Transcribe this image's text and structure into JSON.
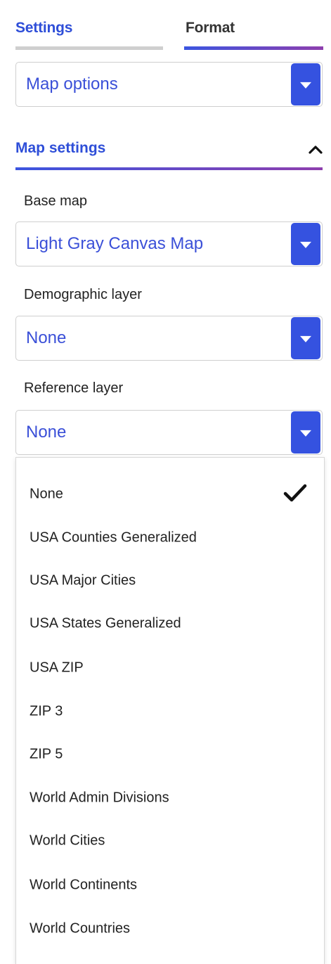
{
  "tabs": {
    "settings": "Settings",
    "format": "Format"
  },
  "map_options": {
    "value": "Map options"
  },
  "section": {
    "title": "Map settings",
    "icon": "chevron-up-icon"
  },
  "base_map": {
    "label": "Base map",
    "value": "Light Gray Canvas Map"
  },
  "demographic_layer": {
    "label": "Demographic layer",
    "value": "None"
  },
  "reference_layer": {
    "label": "Reference layer",
    "value": "None"
  },
  "dropdown": {
    "selected_icon": "check-icon",
    "options": [
      {
        "label": "None",
        "selected": true
      },
      {
        "label": "USA Counties Generalized"
      },
      {
        "label": "USA Major Cities"
      },
      {
        "label": "USA States Generalized"
      },
      {
        "label": "USA ZIP"
      },
      {
        "label": "ZIP 3"
      },
      {
        "label": "ZIP 5"
      },
      {
        "label": "World Admin Divisions"
      },
      {
        "label": "World Cities"
      },
      {
        "label": "World Continents"
      },
      {
        "label": "World Countries"
      }
    ]
  },
  "colors": {
    "accent": "#3552e0",
    "text_link": "#3b50d8",
    "gradient_end": "#8e3fae"
  }
}
